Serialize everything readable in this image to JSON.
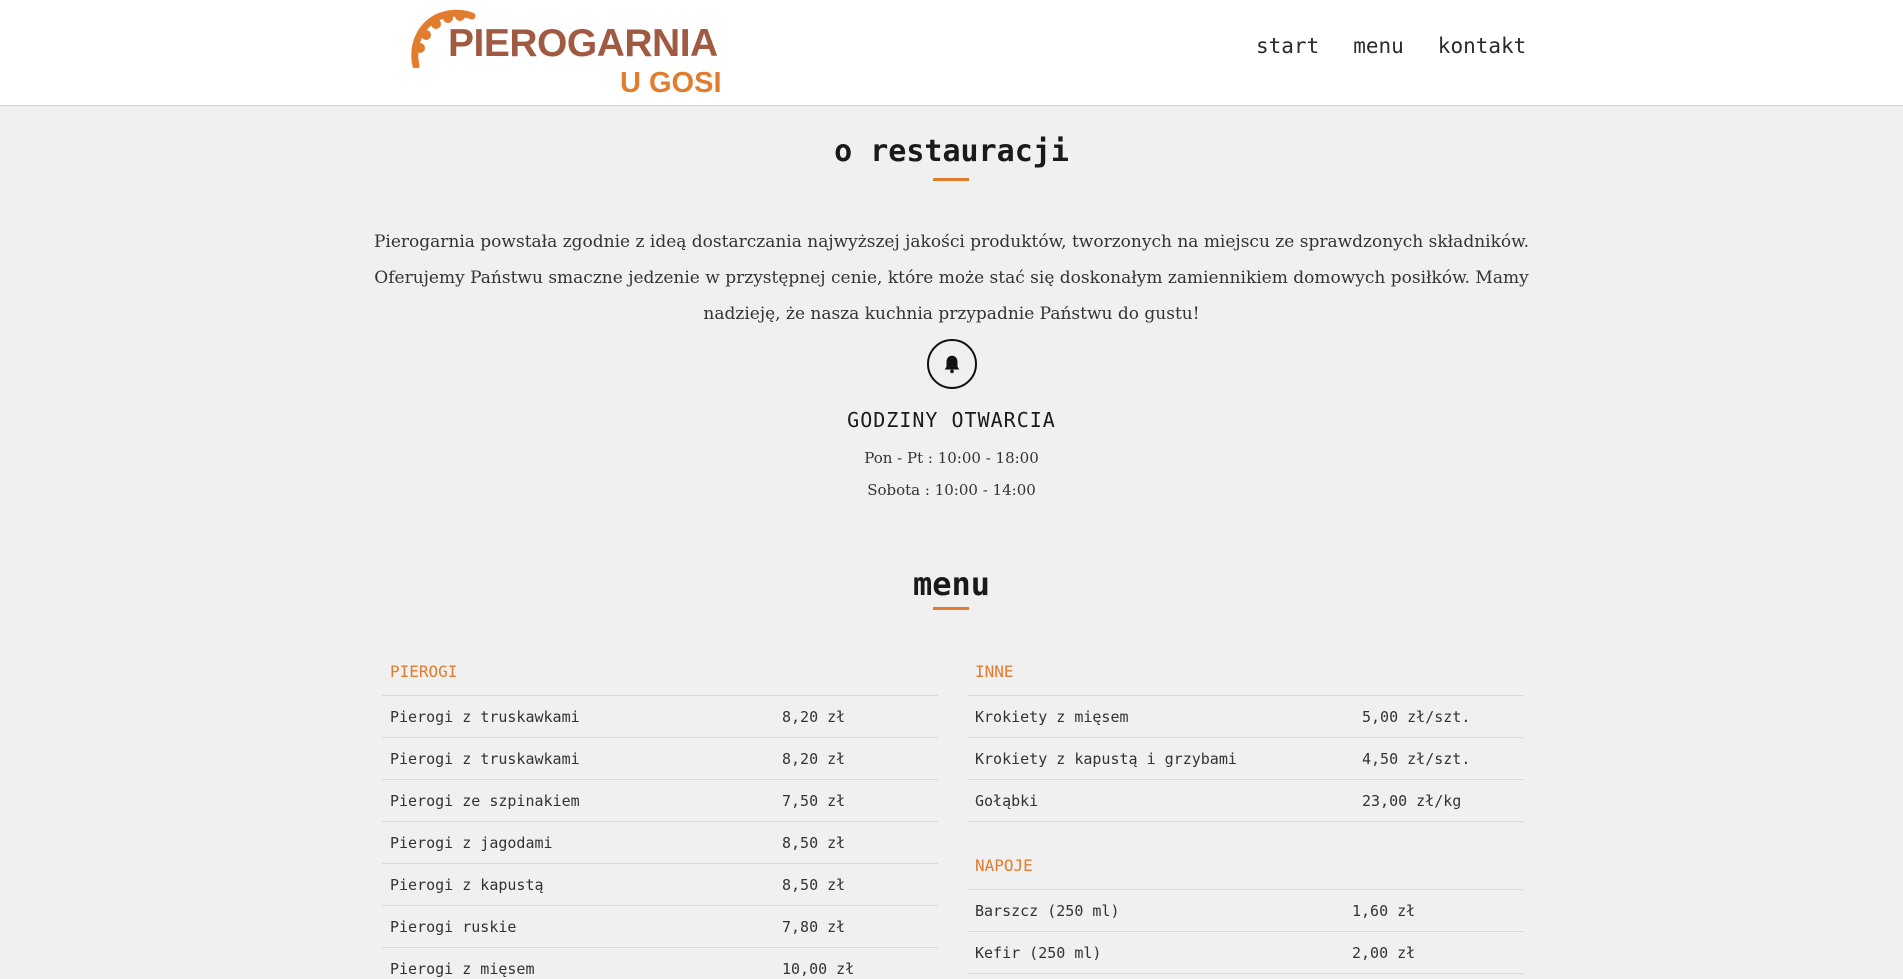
{
  "header": {
    "logo": {
      "line1": "PIEROGARNIA",
      "line2": "U GOSI"
    },
    "nav": [
      {
        "label": "start"
      },
      {
        "label": "menu"
      },
      {
        "label": "kontakt"
      }
    ]
  },
  "about": {
    "title": "o restauracji",
    "text": "Pierogarnia powstała zgodnie z ideą dostarczania najwyższej jakości produktów, tworzonych na miejscu ze sprawdzonych składników. Oferujemy Państwu smaczne jedzenie w przystępnej cenie, które może stać się doskonałym zamiennikiem domowych posiłków. Mamy nadzieję, że nasza kuchnia przypadnie Państwu do gustu!",
    "hours_icon": "bell-icon",
    "hours_title": "GODZINY OTWARCIA",
    "hours": [
      "Pon - Pt : 10:00 - 18:00",
      "Sobota : 10:00 - 14:00"
    ]
  },
  "menu": {
    "title": "menu",
    "pierogi": {
      "title": "PIEROGI",
      "items": [
        {
          "name": "Pierogi z truskawkami",
          "price": "8,20 zł"
        },
        {
          "name": "Pierogi z truskawkami",
          "price": "8,20 zł"
        },
        {
          "name": "Pierogi ze szpinakiem",
          "price": "7,50 zł"
        },
        {
          "name": "Pierogi z jagodami",
          "price": "8,50 zł"
        },
        {
          "name": "Pierogi z kapustą",
          "price": "8,50 zł"
        },
        {
          "name": "Pierogi ruskie",
          "price": "7,80 zł"
        },
        {
          "name": "Pierogi z mięsem",
          "price": "10,00 zł"
        }
      ]
    },
    "inne": {
      "title": "INNE",
      "items": [
        {
          "name": "Krokiety z mięsem",
          "price": "5,00 zł/szt."
        },
        {
          "name": "Krokiety z kapustą i grzybami",
          "price": "4,50 zł/szt."
        },
        {
          "name": "Gołąbki",
          "price": "23,00 zł/kg"
        }
      ]
    },
    "napoje": {
      "title": "NAPOJE",
      "items": [
        {
          "name": "Barszcz (250 ml)",
          "price": "1,60 zł"
        },
        {
          "name": "Kefir (250 ml)",
          "price": "2,00 zł"
        }
      ]
    }
  },
  "colors": {
    "accent": "#e27c2e",
    "logo_brown": "#a15a42",
    "background": "#f0f0f0"
  }
}
